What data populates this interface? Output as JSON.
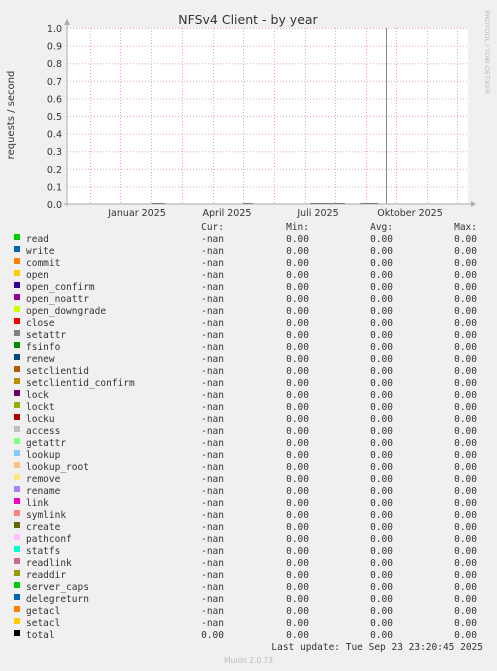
{
  "chart_data": {
    "type": "line",
    "title": "NFSv4 Client - by year",
    "ylabel": "requests / second",
    "ylim": [
      0.0,
      1.0
    ],
    "yticks": [
      "0.0",
      "0.1",
      "0.2",
      "0.3",
      "0.4",
      "0.5",
      "0.6",
      "0.7",
      "0.8",
      "0.9",
      "1.0"
    ],
    "xticks": [
      "Januar 2025",
      "April 2025",
      "Juli 2025",
      "Oktober 2025"
    ],
    "grid": true,
    "side_label": "RRDTOOL / TOBI OETIKER",
    "series_values": "0.00"
  },
  "legend": {
    "headers": {
      "cur": "Cur:",
      "min": "Min:",
      "avg": "Avg:",
      "max": "Max:"
    },
    "rows": [
      {
        "name": "read",
        "color": "#00cc00",
        "cur": "-nan",
        "min": "0.00",
        "avg": "0.00",
        "max": "0.00"
      },
      {
        "name": "write",
        "color": "#0066b3",
        "cur": "-nan",
        "min": "0.00",
        "avg": "0.00",
        "max": "0.00"
      },
      {
        "name": "commit",
        "color": "#ff8000",
        "cur": "-nan",
        "min": "0.00",
        "avg": "0.00",
        "max": "0.00"
      },
      {
        "name": "open",
        "color": "#ffcc00",
        "cur": "-nan",
        "min": "0.00",
        "avg": "0.00",
        "max": "0.00"
      },
      {
        "name": "open_confirm",
        "color": "#330099",
        "cur": "-nan",
        "min": "0.00",
        "avg": "0.00",
        "max": "0.00"
      },
      {
        "name": "open_noattr",
        "color": "#990099",
        "cur": "-nan",
        "min": "0.00",
        "avg": "0.00",
        "max": "0.00"
      },
      {
        "name": "open_downgrade",
        "color": "#ccff00",
        "cur": "-nan",
        "min": "0.00",
        "avg": "0.00",
        "max": "0.00"
      },
      {
        "name": "close",
        "color": "#ff0000",
        "cur": "-nan",
        "min": "0.00",
        "avg": "0.00",
        "max": "0.00"
      },
      {
        "name": "setattr",
        "color": "#808080",
        "cur": "-nan",
        "min": "0.00",
        "avg": "0.00",
        "max": "0.00"
      },
      {
        "name": "fsinfo",
        "color": "#008f00",
        "cur": "-nan",
        "min": "0.00",
        "avg": "0.00",
        "max": "0.00"
      },
      {
        "name": "renew",
        "color": "#00487d",
        "cur": "-nan",
        "min": "0.00",
        "avg": "0.00",
        "max": "0.00"
      },
      {
        "name": "setclientid",
        "color": "#b35a00",
        "cur": "-nan",
        "min": "0.00",
        "avg": "0.00",
        "max": "0.00"
      },
      {
        "name": "setclientid_confirm",
        "color": "#b38f00",
        "cur": "-nan",
        "min": "0.00",
        "avg": "0.00",
        "max": "0.00"
      },
      {
        "name": "lock",
        "color": "#6b006b",
        "cur": "-nan",
        "min": "0.00",
        "avg": "0.00",
        "max": "0.00"
      },
      {
        "name": "lockt",
        "color": "#8fb300",
        "cur": "-nan",
        "min": "0.00",
        "avg": "0.00",
        "max": "0.00"
      },
      {
        "name": "locku",
        "color": "#b30000",
        "cur": "-nan",
        "min": "0.00",
        "avg": "0.00",
        "max": "0.00"
      },
      {
        "name": "access",
        "color": "#bebebe",
        "cur": "-nan",
        "min": "0.00",
        "avg": "0.00",
        "max": "0.00"
      },
      {
        "name": "getattr",
        "color": "#80ff80",
        "cur": "-nan",
        "min": "0.00",
        "avg": "0.00",
        "max": "0.00"
      },
      {
        "name": "lookup",
        "color": "#80c9ff",
        "cur": "-nan",
        "min": "0.00",
        "avg": "0.00",
        "max": "0.00"
      },
      {
        "name": "lookup_root",
        "color": "#ffc080",
        "cur": "-nan",
        "min": "0.00",
        "avg": "0.00",
        "max": "0.00"
      },
      {
        "name": "remove",
        "color": "#ffe680",
        "cur": "-nan",
        "min": "0.00",
        "avg": "0.00",
        "max": "0.00"
      },
      {
        "name": "rename",
        "color": "#aa80ff",
        "cur": "-nan",
        "min": "0.00",
        "avg": "0.00",
        "max": "0.00"
      },
      {
        "name": "link",
        "color": "#ee00cc",
        "cur": "-nan",
        "min": "0.00",
        "avg": "0.00",
        "max": "0.00"
      },
      {
        "name": "symlink",
        "color": "#ff8080",
        "cur": "-nan",
        "min": "0.00",
        "avg": "0.00",
        "max": "0.00"
      },
      {
        "name": "create",
        "color": "#666600",
        "cur": "-nan",
        "min": "0.00",
        "avg": "0.00",
        "max": "0.00"
      },
      {
        "name": "pathconf",
        "color": "#ffbfff",
        "cur": "-nan",
        "min": "0.00",
        "avg": "0.00",
        "max": "0.00"
      },
      {
        "name": "statfs",
        "color": "#00ffcc",
        "cur": "-nan",
        "min": "0.00",
        "avg": "0.00",
        "max": "0.00"
      },
      {
        "name": "readlink",
        "color": "#cc6699",
        "cur": "-nan",
        "min": "0.00",
        "avg": "0.00",
        "max": "0.00"
      },
      {
        "name": "readdir",
        "color": "#999900",
        "cur": "-nan",
        "min": "0.00",
        "avg": "0.00",
        "max": "0.00"
      },
      {
        "name": "server_caps",
        "color": "#00cc00",
        "cur": "-nan",
        "min": "0.00",
        "avg": "0.00",
        "max": "0.00"
      },
      {
        "name": "delegreturn",
        "color": "#0066b3",
        "cur": "-nan",
        "min": "0.00",
        "avg": "0.00",
        "max": "0.00"
      },
      {
        "name": "getacl",
        "color": "#ff8000",
        "cur": "-nan",
        "min": "0.00",
        "avg": "0.00",
        "max": "0.00"
      },
      {
        "name": "setacl",
        "color": "#ffcc00",
        "cur": "-nan",
        "min": "0.00",
        "avg": "0.00",
        "max": "0.00"
      },
      {
        "name": "total",
        "color": "#000000",
        "cur": "0.00",
        "min": "0.00",
        "avg": "0.00",
        "max": "0.00"
      }
    ]
  },
  "footer": {
    "last_update": "Last update: Tue Sep 23 23:20:45 2025",
    "munin_version": "Munin 2.0.73"
  }
}
